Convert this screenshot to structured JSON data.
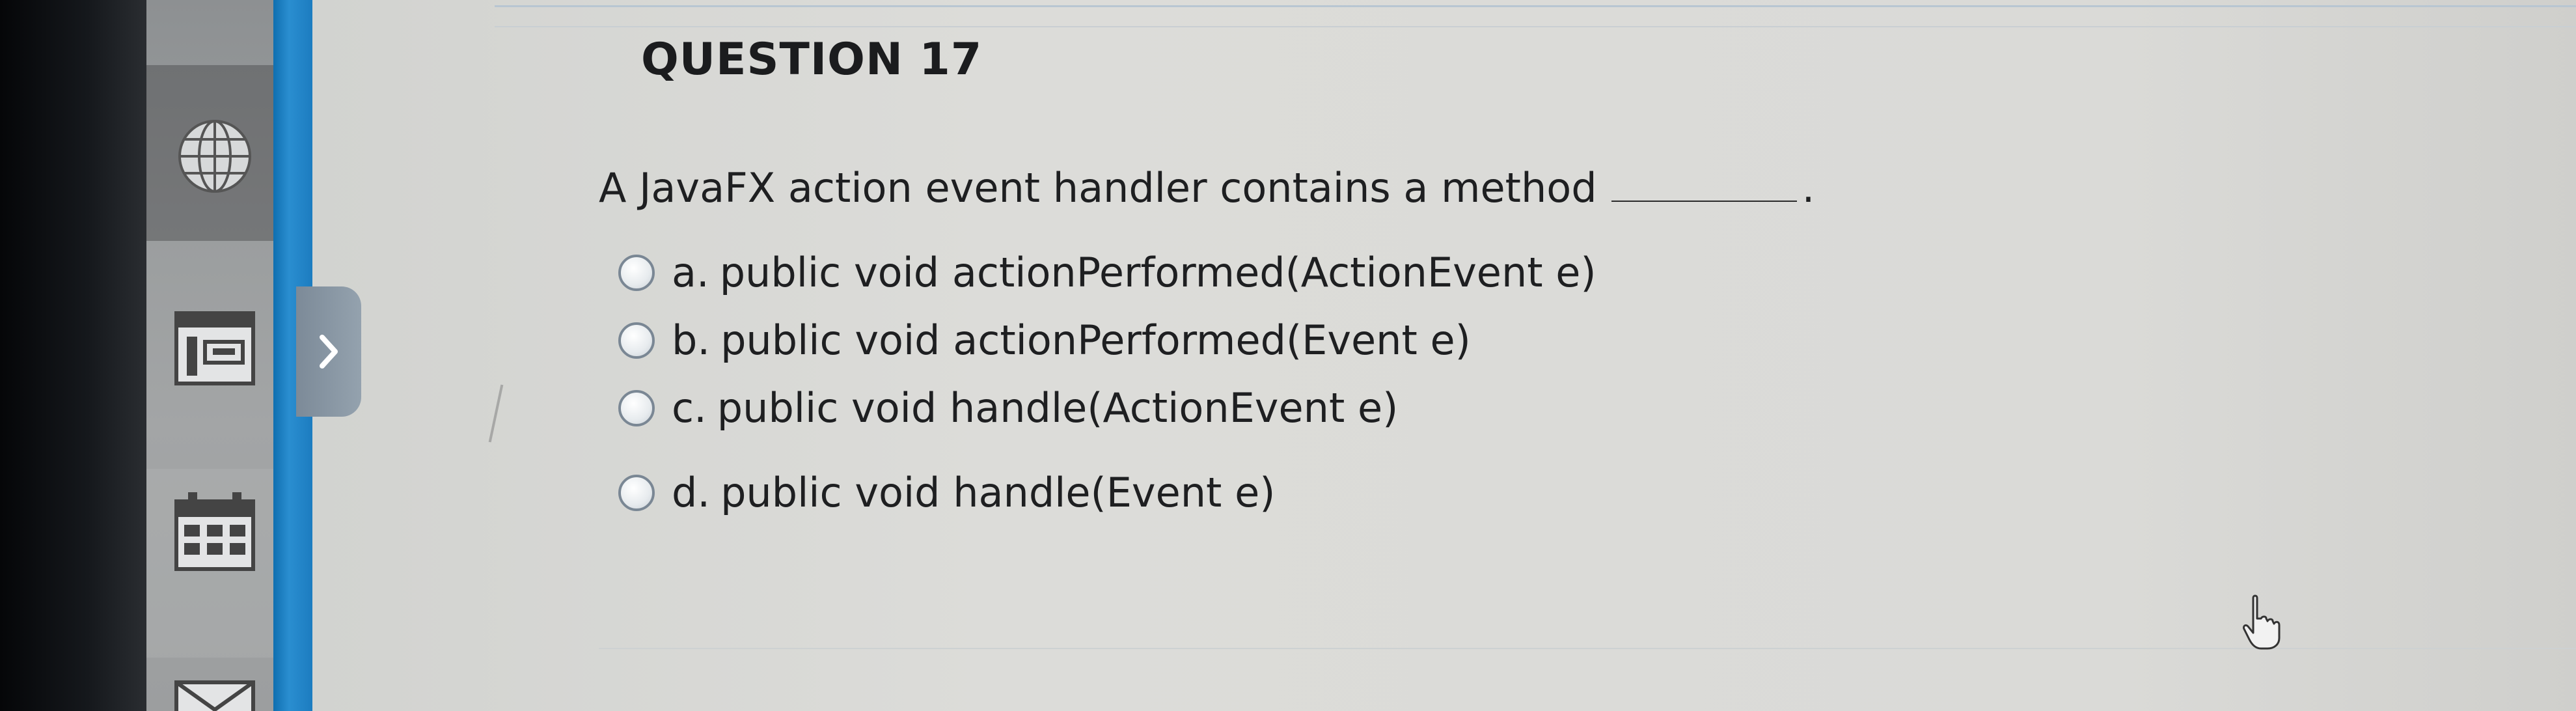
{
  "question": {
    "title": "QUESTION 17",
    "prompt": "A JavaFX action event handler contains a method",
    "prompt_end": ".",
    "options": [
      {
        "letter": "a.",
        "text": "public void actionPerformed(ActionEvent e)"
      },
      {
        "letter": "b.",
        "text": "public void actionPerformed(Event e)"
      },
      {
        "letter": "c.",
        "text": "public void handle(ActionEvent e)"
      },
      {
        "letter": "d.",
        "text": "public void handle(Event e)"
      }
    ]
  },
  "nav": {
    "icons": [
      "globe-icon",
      "content-icon",
      "calendar-icon",
      "mail-icon"
    ]
  },
  "colors": {
    "accent": "#1c7cc0",
    "text": "#1e1f21"
  }
}
